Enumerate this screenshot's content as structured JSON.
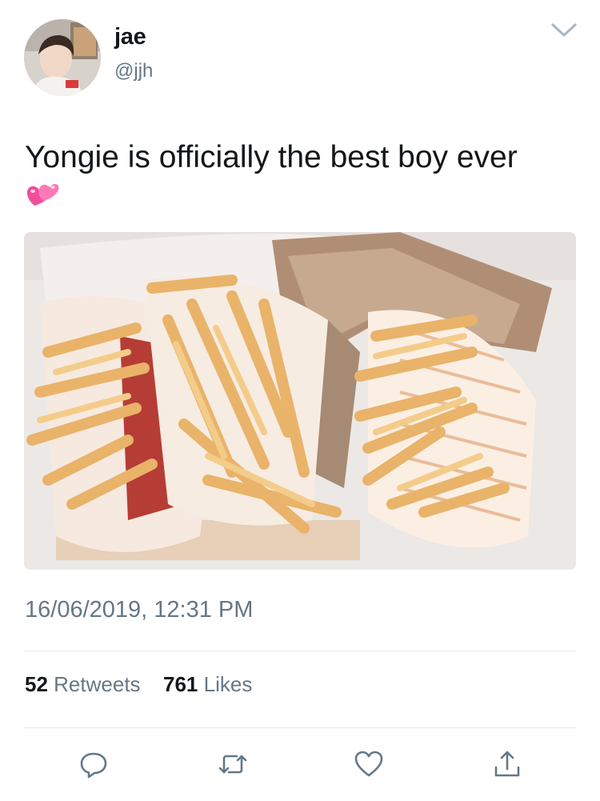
{
  "user": {
    "display_name": "jae",
    "handle": "@jjh"
  },
  "tweet": {
    "text": "Yongie is officially the best boy ever",
    "emoji": "💞",
    "media_icon": "photo-fries",
    "timestamp": "16/06/2019, 12:31 PM"
  },
  "stats": {
    "retweets_count": "52",
    "retweets_label": "Retweets",
    "likes_count": "761",
    "likes_label": "Likes"
  },
  "actions": {
    "reply_icon": "reply-icon",
    "retweet_icon": "retweet-icon",
    "like_icon": "heart-icon",
    "share_icon": "share-icon"
  },
  "colors": {
    "text": "#14171a",
    "secondary": "#657786",
    "divider": "#e1e8ed",
    "emoji_pink": "#ff4fa0"
  }
}
